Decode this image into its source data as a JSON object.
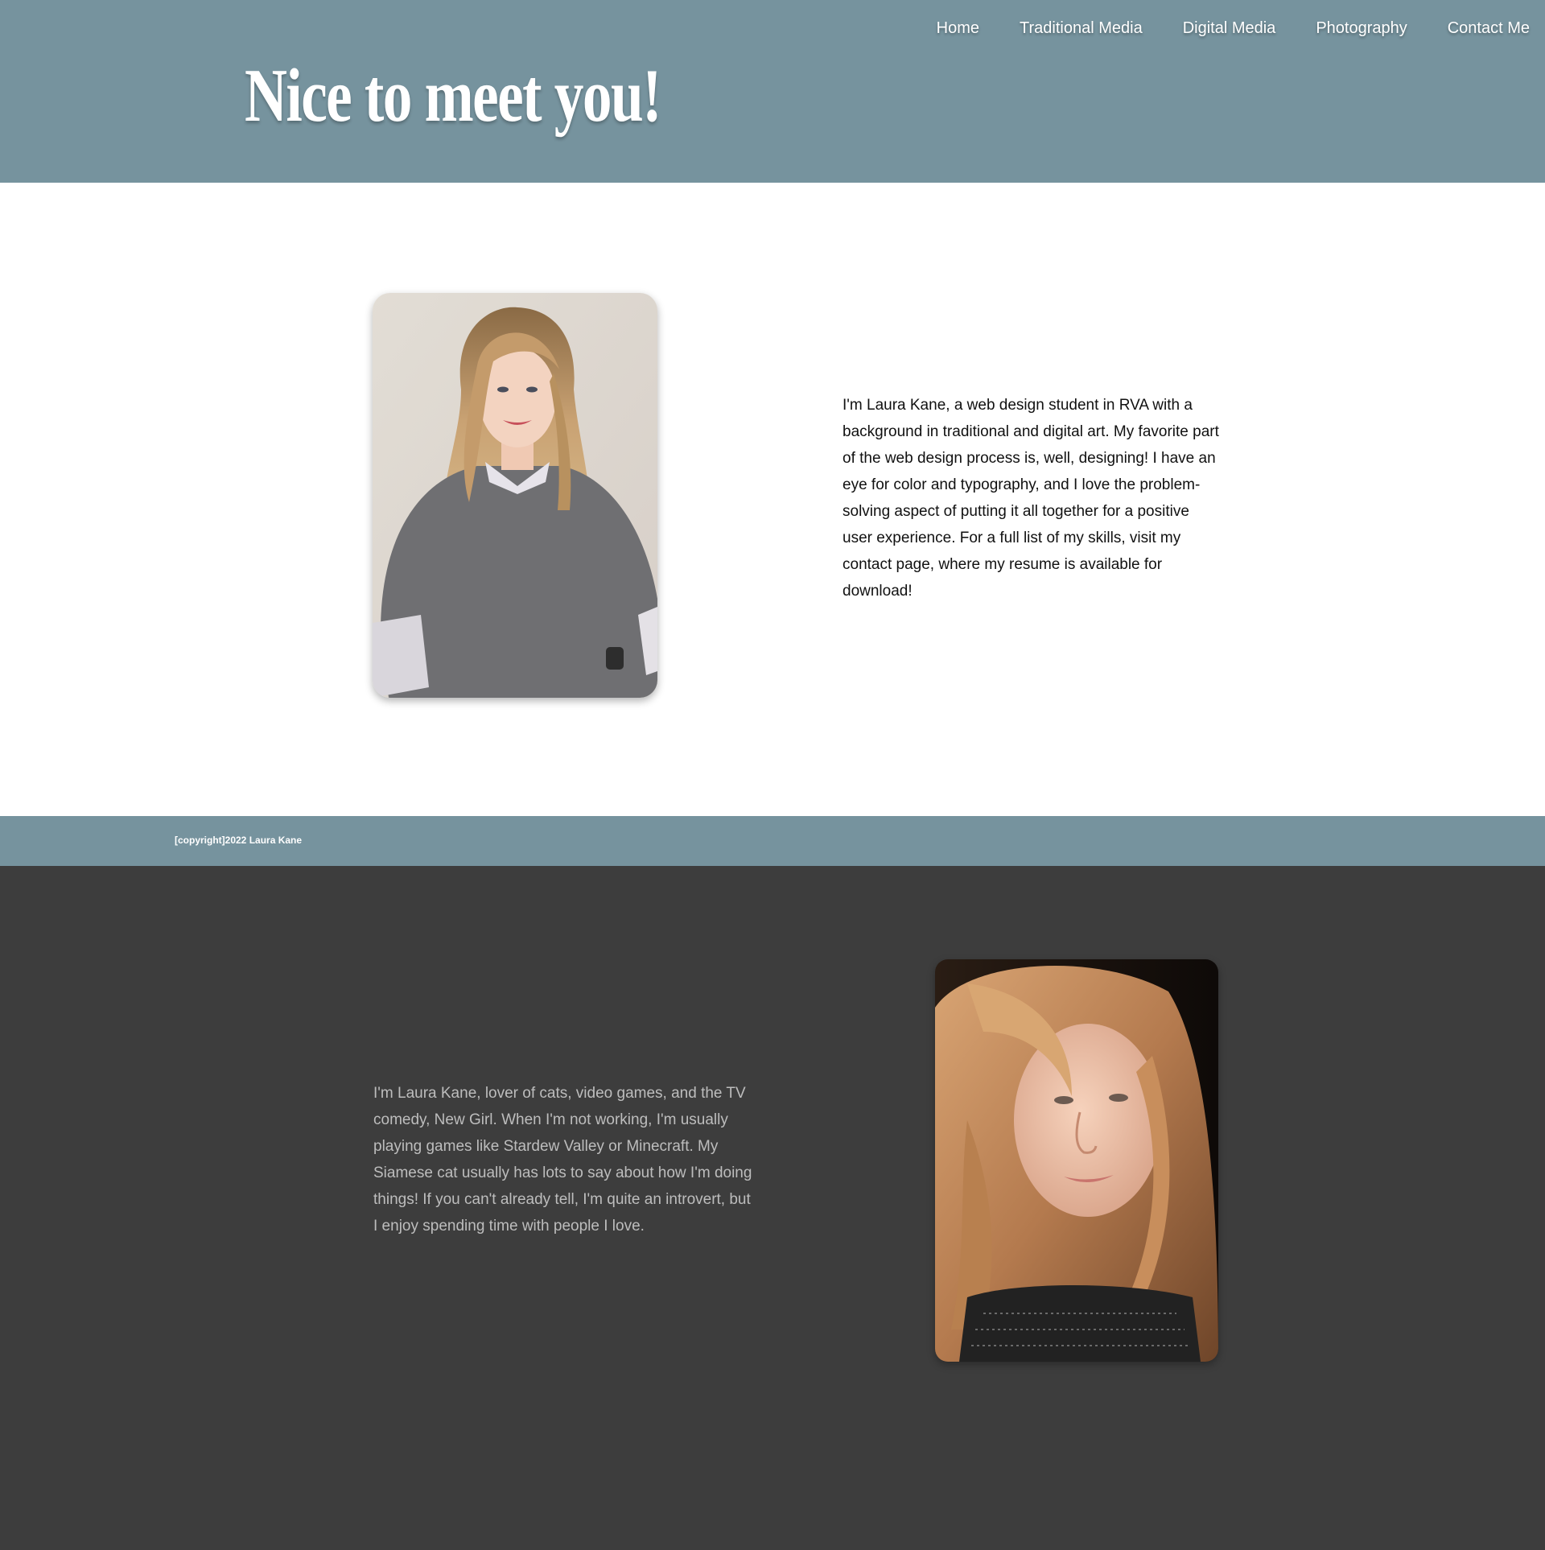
{
  "header": {
    "title": "Nice to meet you!",
    "background": "#76939e",
    "nav": [
      {
        "label": "Home"
      },
      {
        "label": "Traditional Media"
      },
      {
        "label": "Digital Media"
      },
      {
        "label": "Photography"
      },
      {
        "label": "Contact Me"
      }
    ]
  },
  "about_professional": {
    "bio": "I'm Laura Kane, a web design student in RVA with a background in traditional and digital art. My favorite part of the web design process is, well, designing! I have an eye for color and typography, and I love the problem-solving aspect of putting it all together for a positive user experience. For a full list of my skills, visit my contact page, where my resume is available for download!"
  },
  "footer": {
    "copyright": "[copyright]2022 Laura Kane"
  },
  "about_personal": {
    "background": "#3d3d3d",
    "bio": "I'm Laura Kane, lover of cats, video games, and the TV comedy, New Girl. When I'm not working, I'm usually playing games like Stardew Valley or Minecraft. My Siamese cat usually has lots to say about how I'm doing things! If you can't already tell, I'm quite an introvert, but I enjoy spending time with people I love."
  }
}
